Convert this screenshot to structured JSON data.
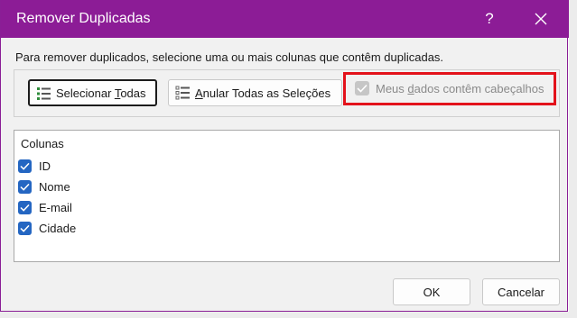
{
  "window": {
    "title": "Remover Duplicadas",
    "help_label": "?"
  },
  "instruction": "Para remover duplicados, selecione uma ou mais colunas que contêm duplicadas.",
  "toolbar": {
    "select_all_pre": "Selecionar ",
    "select_all_u": "T",
    "select_all_post": "odas",
    "deselect_all_u": "A",
    "deselect_all_post": "nular Todas as Seleções",
    "headers_pre": "Meus ",
    "headers_u": "d",
    "headers_post": "ados contêm cabeçalhos",
    "headers_checked": true,
    "headers_disabled": true
  },
  "columns": {
    "header": "Colunas",
    "items": [
      {
        "label": "ID",
        "checked": true
      },
      {
        "label": "Nome",
        "checked": true
      },
      {
        "label": "E-mail",
        "checked": true
      },
      {
        "label": "Cidade",
        "checked": true
      }
    ]
  },
  "footer": {
    "ok_label": "OK",
    "cancel_label": "Cancelar"
  },
  "colors": {
    "titlebar": "#8c1c96",
    "checkbox": "#2466c2",
    "highlight": "#e3121b"
  }
}
